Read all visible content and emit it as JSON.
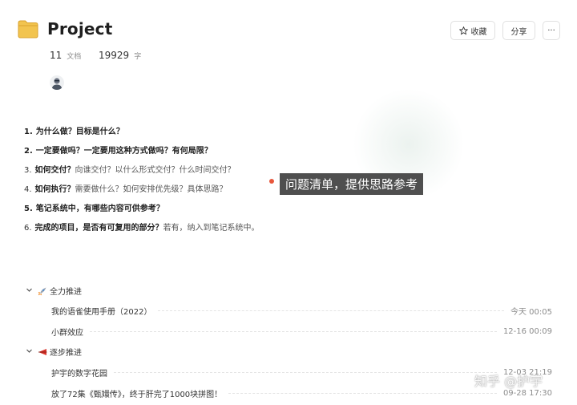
{
  "page": {
    "title": "Project",
    "folder_icon": "folder-icon",
    "accent_folder": "#f2c44f"
  },
  "actions": {
    "favorite_label": "收藏",
    "share_label": "分享",
    "more_label": "···"
  },
  "stats": {
    "docs_count": "11",
    "docs_unit": "文档",
    "words_count": "19929",
    "words_unit": "字"
  },
  "questions": [
    {
      "n": "1.",
      "bold": "为什么做？目标是什么？",
      "rest": ""
    },
    {
      "n": "2.",
      "bold": "一定要做吗？一定要用这种方式做吗？有何局限？",
      "rest": ""
    },
    {
      "n": "3.",
      "bold": "如何交付？",
      "rest": "向谁交付？以什么形式交付？什么时间交付？"
    },
    {
      "n": "4.",
      "bold": "如何执行？",
      "rest": "需要做什么？如何安排优先级？具体思路？"
    },
    {
      "n": "5.",
      "bold": "笔记系统中，有哪些内容可供参考？",
      "rest": ""
    },
    {
      "n": "6.",
      "bold": "完成的项目，是否有可复用的部分？",
      "rest": "若有，纳入到笔记系统中。"
    }
  ],
  "annotation": {
    "text": "问题清单，提供思路参考",
    "dot_color": "#e8573c"
  },
  "groups": [
    {
      "label": "全力推进",
      "icon": "rocket-icon",
      "items": [
        {
          "name": "我的语雀使用手册（2022）",
          "date": "今天 00:05"
        },
        {
          "name": "小群效应",
          "date": "12-16 00:09"
        }
      ]
    },
    {
      "label": "逐步推进",
      "icon": "red-flag-icon",
      "items": [
        {
          "name": "护宇的数字花园",
          "date": "12-03 21:19"
        },
        {
          "name": "放了72集《甄嬛传》，终于肝完了1000块拼图！",
          "date": "09-28 17:30"
        }
      ]
    }
  ],
  "watermark": "知乎 @护宇"
}
